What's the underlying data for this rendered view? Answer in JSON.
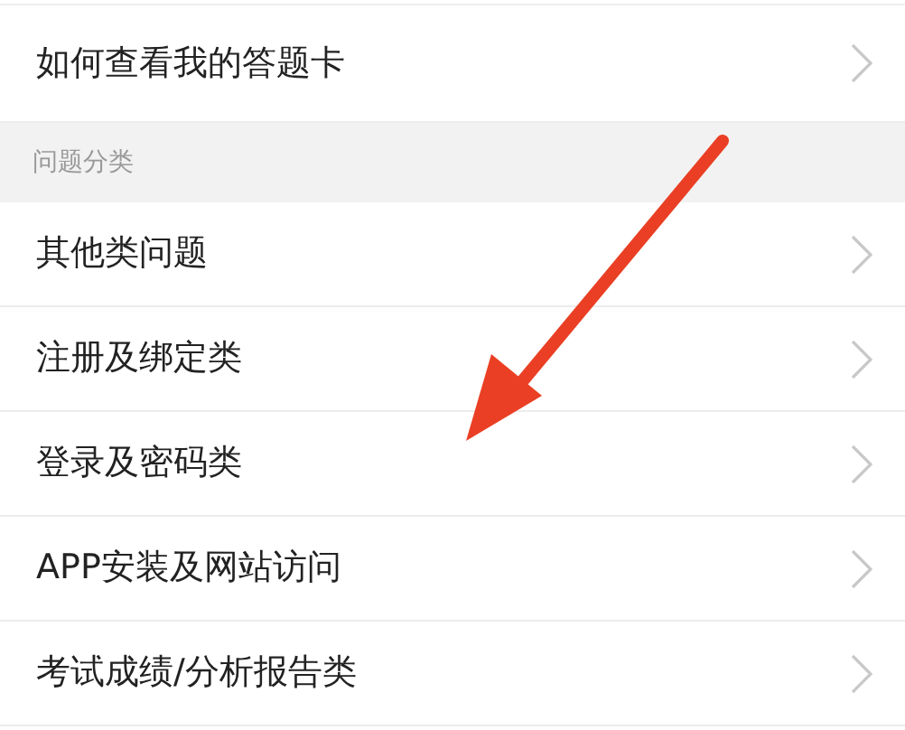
{
  "top_item": {
    "label": "如何查看我的答题卡"
  },
  "section": {
    "title": "问题分类"
  },
  "items": [
    {
      "label": "其他类问题"
    },
    {
      "label": "注册及绑定类"
    },
    {
      "label": "登录及密码类"
    },
    {
      "label": "APP安装及网站访问"
    },
    {
      "label": "考试成绩/分析报告类"
    }
  ]
}
